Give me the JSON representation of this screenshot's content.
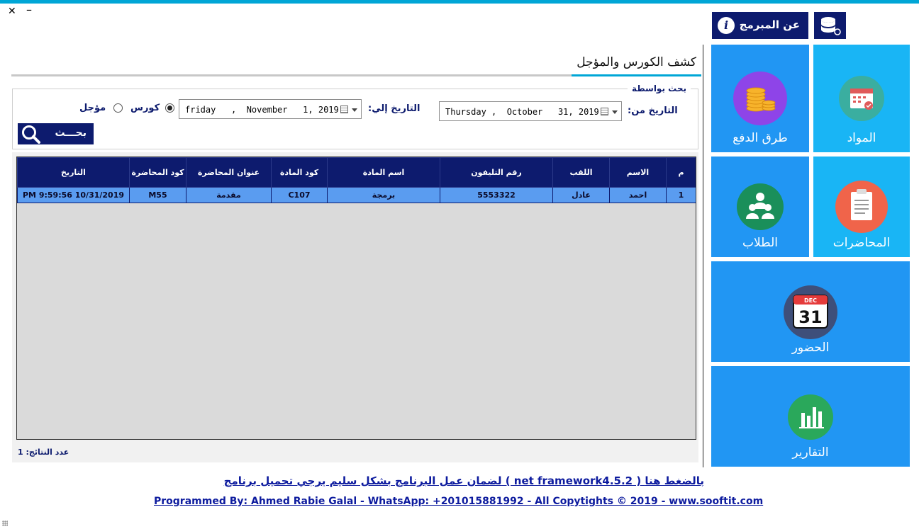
{
  "window": {
    "close_glyph": "✕",
    "minimize_glyph": "–"
  },
  "header": {
    "about_label": "عن المبرمج",
    "about_icon": "info-icon",
    "db_icon": "database-icon"
  },
  "tiles": [
    {
      "id": "subjects",
      "label": "المواد",
      "icon": "calendar-icon",
      "color": "#1fb5f5"
    },
    {
      "id": "payment",
      "label": "طرق الدفع",
      "icon": "coins-icon",
      "color": "#2196f3"
    },
    {
      "id": "lectures",
      "label": "المحاضرات",
      "icon": "clipboard-icon",
      "color": "#1fb5f5"
    },
    {
      "id": "students",
      "label": "الطلاب",
      "icon": "users-icon",
      "color": "#2196f3"
    },
    {
      "id": "attendance",
      "label": "الحضور",
      "icon": "calendar-31-icon",
      "cal_month": "DEC",
      "cal_day": "31",
      "color": "#2196f3"
    },
    {
      "id": "reports",
      "label": "التقارير",
      "icon": "bar-chart-icon",
      "color": "#2196f3"
    }
  ],
  "page": {
    "title": "كشف الكورس والمؤجل"
  },
  "search": {
    "legend": "بحث بواسطة",
    "from_label": "التاريخ من:",
    "from_value": "Thursday ,  October   31, 2019",
    "to_label": "التاريخ إلي:",
    "to_value": "friday   ,  November   1, 2019",
    "radio_course": "كورس",
    "radio_deferred": "مؤجل",
    "selected": "course",
    "button_label": "بحـــث"
  },
  "grid": {
    "columns": [
      "م",
      "الاسم",
      "اللقب",
      "رقم التليفون",
      "اسم المادة",
      "كود المادة",
      "عنوان المحاضرة",
      "كود المحاضرة",
      "التاريخ"
    ],
    "rows": [
      [
        "1",
        "احمد",
        "عادل",
        "5553322",
        "برمجة",
        "C107",
        "مقدمة",
        "M55",
        "10/31/2019 9:59:56 PM"
      ]
    ],
    "count_text": "عدد النتائج: 1"
  },
  "footer": {
    "link_net": "لضمان عمل البرنامج بشكل سليم يرجي تحميل برنامج ( net framework4.5.2 ) بالضغط هنا",
    "credits": "Programmed By: Ahmed Rabie Galal - WhatsApp: +201015881992 - All Copytights © 2019 - www.sooftit.com"
  },
  "colors": {
    "accent": "#00a6d6",
    "navy": "#0d1b6e",
    "tile_blue": "#2196f3",
    "tile_light": "#19b5f5",
    "row_blue": "#5a9cf0"
  }
}
